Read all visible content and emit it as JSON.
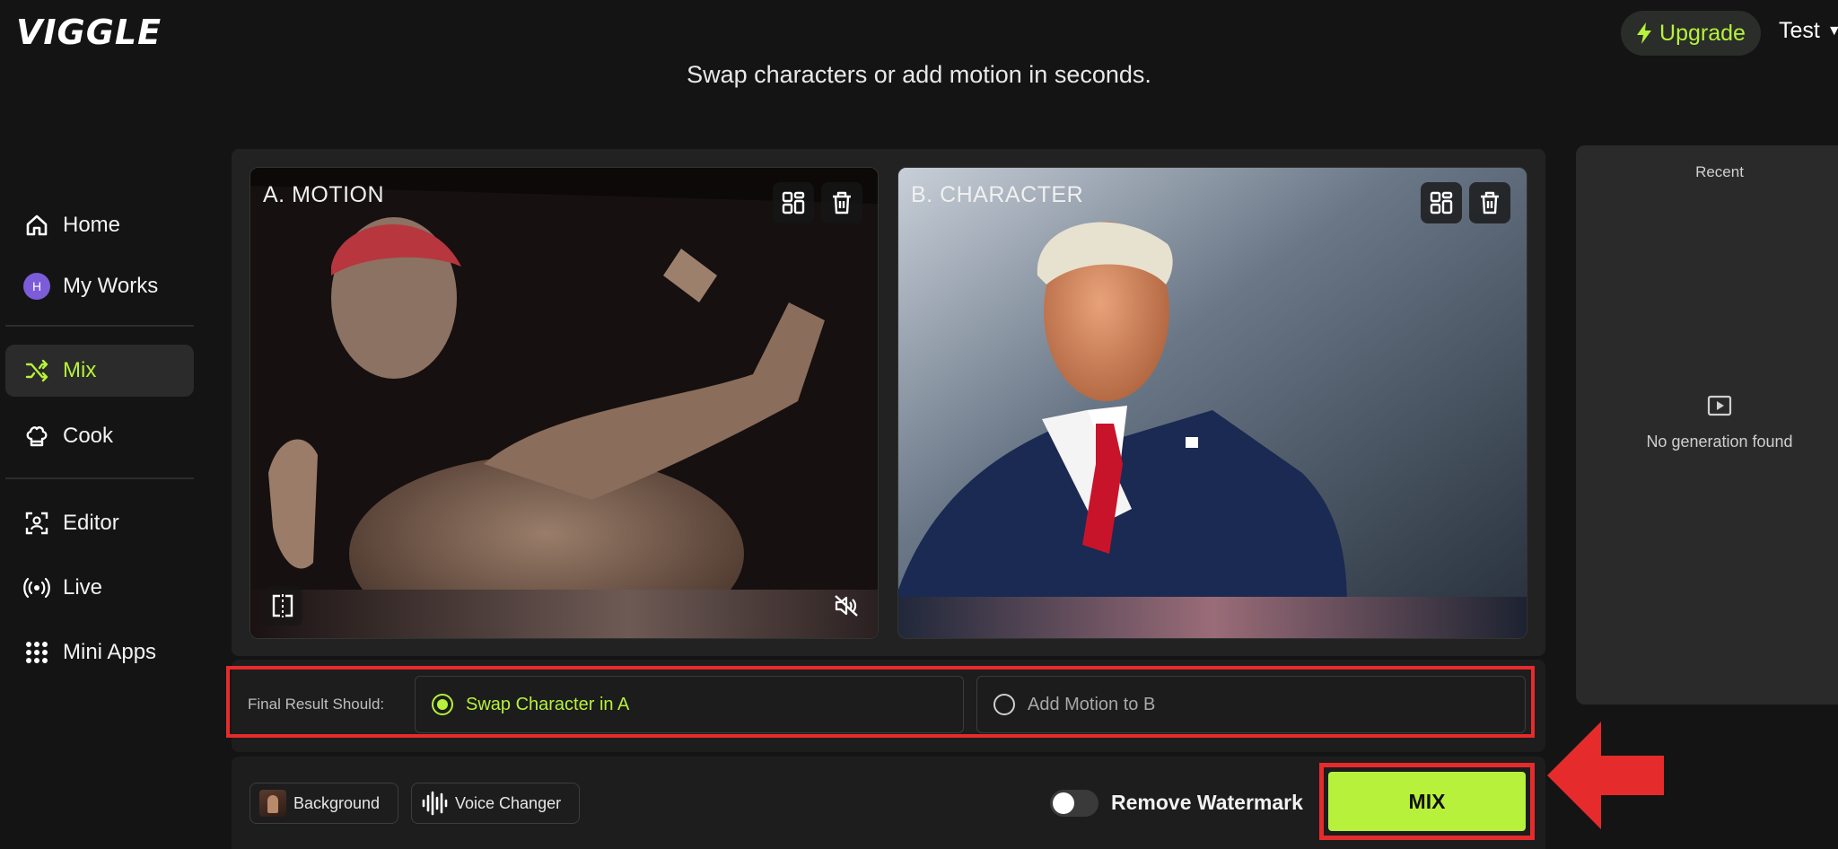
{
  "header": {
    "logo": "VIGGLE",
    "tagline": "Swap characters or add motion in seconds.",
    "upgrade_label": "Upgrade",
    "user_label": "Test"
  },
  "sidebar": {
    "items": [
      {
        "label": "Home",
        "icon": "home-icon"
      },
      {
        "label": "My Works",
        "icon": "avatar",
        "avatar_letter": "H"
      },
      {
        "label": "Mix",
        "icon": "shuffle-icon",
        "active": true
      },
      {
        "label": "Cook",
        "icon": "chef-hat-icon"
      },
      {
        "label": "Editor",
        "icon": "editor-icon"
      },
      {
        "label": "Live",
        "icon": "broadcast-icon"
      },
      {
        "label": "Mini Apps",
        "icon": "grid-icon"
      }
    ]
  },
  "cards": {
    "motion_label": "A. MOTION",
    "character_label": "B. CHARACTER"
  },
  "result": {
    "label": "Final Result Should:",
    "option_a": "Swap Character in A",
    "option_b": "Add Motion to B",
    "selected": "option_a"
  },
  "toolbar": {
    "background_label": "Background",
    "voice_changer_label": "Voice Changer",
    "remove_watermark_label": "Remove Watermark",
    "remove_watermark_on": false,
    "mix_label": "MIX"
  },
  "recent": {
    "title": "Recent",
    "empty_text": "No generation found"
  },
  "colors": {
    "accent": "#b7f13b",
    "highlight_red": "#e52b2b",
    "background": "#141414"
  }
}
